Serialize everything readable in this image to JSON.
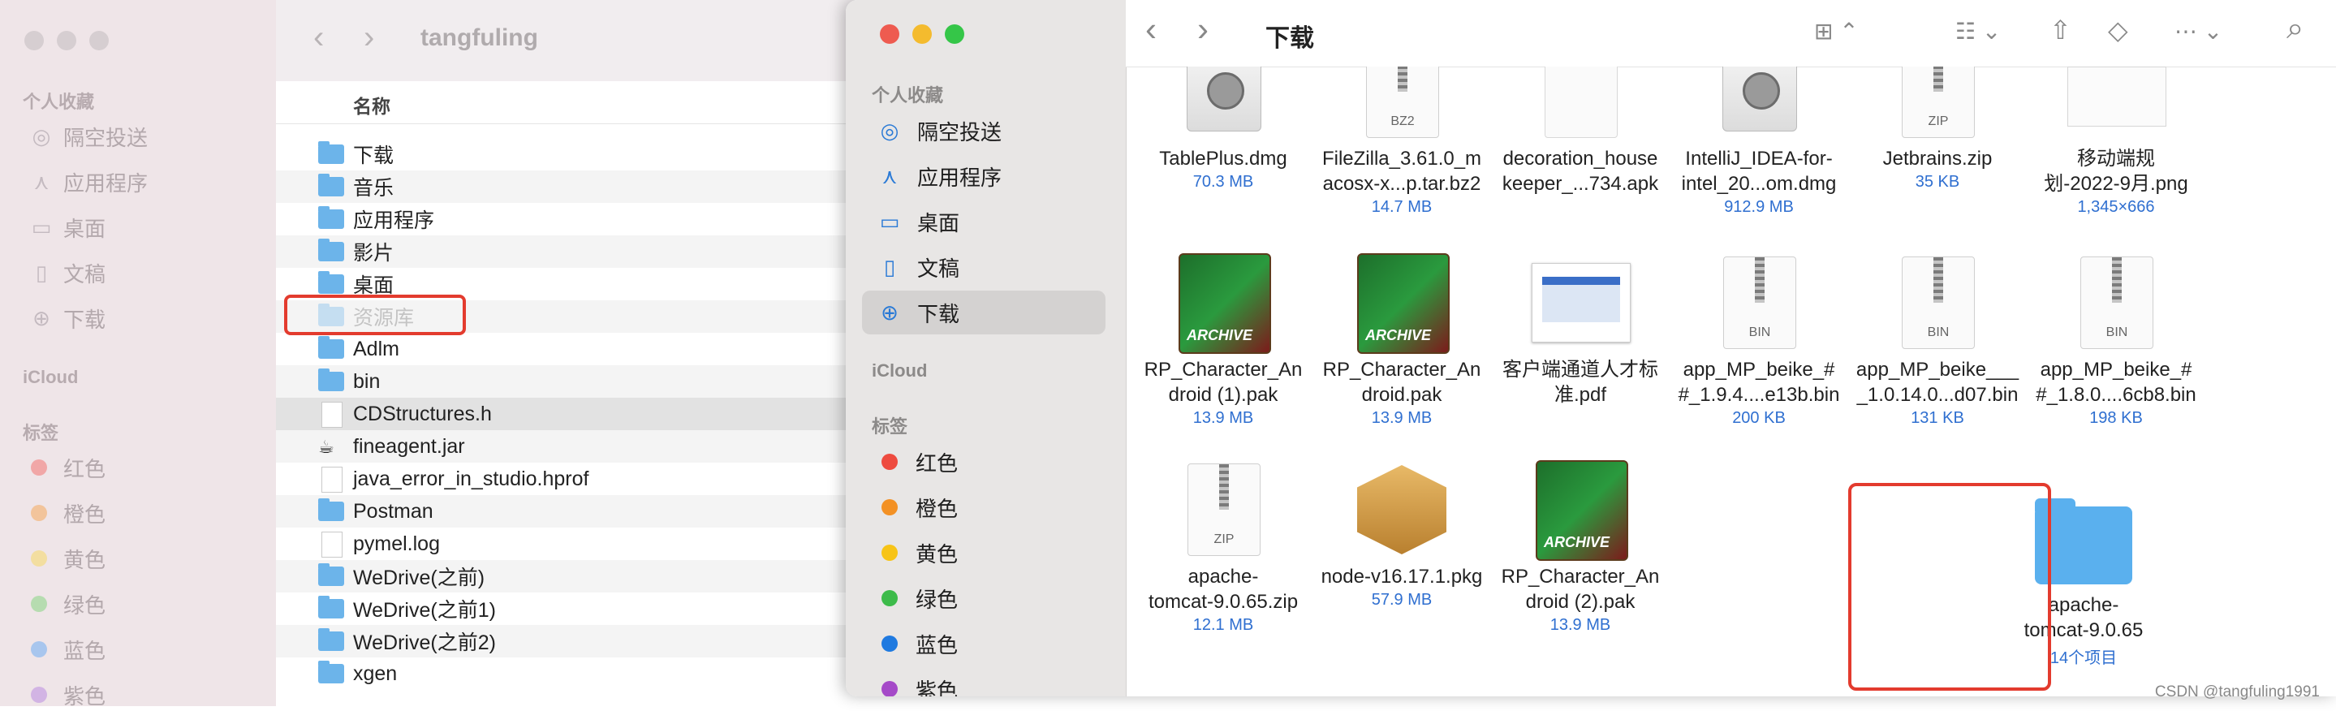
{
  "back_window": {
    "title": "tangfuling",
    "sidebar": {
      "favorites_header": "个人收藏",
      "favorites": [
        {
          "label": "隔空投送",
          "icon": "airdrop-icon"
        },
        {
          "label": "应用程序",
          "icon": "applications-icon"
        },
        {
          "label": "桌面",
          "icon": "desktop-icon"
        },
        {
          "label": "文稿",
          "icon": "document-icon"
        },
        {
          "label": "下载",
          "icon": "download-icon"
        }
      ],
      "icloud_header": "iCloud",
      "tags_header": "标签",
      "tags": [
        {
          "label": "红色",
          "color": "#f1a7a7"
        },
        {
          "label": "橙色",
          "color": "#f2c49b"
        },
        {
          "label": "黄色",
          "color": "#f3dea0"
        },
        {
          "label": "绿色",
          "color": "#b6dcb0"
        },
        {
          "label": "蓝色",
          "color": "#a8c6ee"
        },
        {
          "label": "紫色",
          "color": "#d2b4e4"
        }
      ]
    },
    "column_header": "名称",
    "rows": [
      {
        "name": "下载",
        "type": "folder"
      },
      {
        "name": "音乐",
        "type": "folder"
      },
      {
        "name": "应用程序",
        "type": "folder"
      },
      {
        "name": "影片",
        "type": "folder"
      },
      {
        "name": "桌面",
        "type": "folder"
      },
      {
        "name": "资源库",
        "type": "folder-dim"
      },
      {
        "name": "Adlm",
        "type": "folder"
      },
      {
        "name": "bin",
        "type": "folder"
      },
      {
        "name": "CDStructures.h",
        "type": "doc"
      },
      {
        "name": "fineagent.jar",
        "type": "jar"
      },
      {
        "name": "java_error_in_studio.hprof",
        "type": "doc"
      },
      {
        "name": "Postman",
        "type": "folder"
      },
      {
        "name": "pymel.log",
        "type": "doc"
      },
      {
        "name": "WeDrive(之前)",
        "type": "folder"
      },
      {
        "name": "WeDrive(之前1)",
        "type": "folder"
      },
      {
        "name": "WeDrive(之前2)",
        "type": "folder"
      },
      {
        "name": "xgen",
        "type": "folder"
      }
    ]
  },
  "front_window": {
    "title": "下载",
    "sidebar": {
      "favorites_header": "个人收藏",
      "favorites": [
        {
          "label": "隔空投送",
          "icon": "airdrop-icon"
        },
        {
          "label": "应用程序",
          "icon": "applications-icon"
        },
        {
          "label": "桌面",
          "icon": "desktop-icon"
        },
        {
          "label": "文稿",
          "icon": "document-icon"
        },
        {
          "label": "下载",
          "icon": "download-icon",
          "active": true
        }
      ],
      "icloud_header": "iCloud",
      "tags_header": "标签",
      "tags": [
        {
          "label": "红色",
          "color": "#ee4b3f"
        },
        {
          "label": "橙色",
          "color": "#f39124"
        },
        {
          "label": "黄色",
          "color": "#f7c417"
        },
        {
          "label": "绿色",
          "color": "#3dbb4a"
        },
        {
          "label": "蓝色",
          "color": "#1f7ae0"
        },
        {
          "label": "紫色",
          "color": "#a54ac8"
        }
      ]
    },
    "toolbar": {
      "back_icon": "‹",
      "forward_icon": "›",
      "view_icon": "⊞ ⌃",
      "group_icon": "☷ ⌄",
      "share_icon": "⇧",
      "tag_icon": "◇",
      "more_icon": "⋯ ⌄",
      "search_icon": "⌕"
    },
    "files": [
      {
        "name": "TablePlus.dmg",
        "sub": "70.3 MB",
        "kind": "dmg"
      },
      {
        "name": "FileZilla_3.61.0_m\nacosx-x...p.tar.bz2",
        "sub": "14.7 MB",
        "kind": "zip",
        "badge": "BZ2"
      },
      {
        "name": "decoration_house\nkeeper_...734.apk",
        "sub": "",
        "kind": "blank"
      },
      {
        "name": "IntelliJ_IDEA-for-\nintel_20...om.dmg",
        "sub": "912.9 MB",
        "kind": "dmg"
      },
      {
        "name": "Jetbrains.zip",
        "sub": "35 KB",
        "kind": "zip",
        "badge": "ZIP"
      },
      {
        "name": "移动端规\n划-2022-9月.png",
        "sub": "1,345×666",
        "kind": "png"
      },
      {
        "name": "RP_Character_An\ndroid (1).pak",
        "sub": "13.9 MB",
        "kind": "archive"
      },
      {
        "name": "RP_Character_An\ndroid.pak",
        "sub": "13.9 MB",
        "kind": "archive"
      },
      {
        "name": "客户端通道人才标\n准.pdf",
        "sub": "",
        "kind": "pdf"
      },
      {
        "name": "app_MP_beike_#\n#_1.9.4....e13b.bin",
        "sub": "200 KB",
        "kind": "zip",
        "badge": "BIN"
      },
      {
        "name": "app_MP_beike___\n_1.0.14.0...d07.bin",
        "sub": "131 KB",
        "kind": "zip",
        "badge": "BIN"
      },
      {
        "name": "app_MP_beike_#\n#_1.8.0....6cb8.bin",
        "sub": "198 KB",
        "kind": "zip",
        "badge": "BIN"
      },
      {
        "name": "apache-\ntomcat-9.0.65.zip",
        "sub": "12.1 MB",
        "kind": "zip",
        "badge": "ZIP"
      },
      {
        "name": "node-v16.17.1.pkg",
        "sub": "57.9 MB",
        "kind": "pkg"
      },
      {
        "name": "RP_Character_An\ndroid (2).pak",
        "sub": "13.9 MB",
        "kind": "archive"
      },
      {
        "name": "apache-\ntomcat-9.0.65",
        "sub": "14个项目",
        "kind": "folder"
      }
    ],
    "archive_label": "ARCHIVE"
  },
  "watermark": "CSDN @tangfuling1991"
}
